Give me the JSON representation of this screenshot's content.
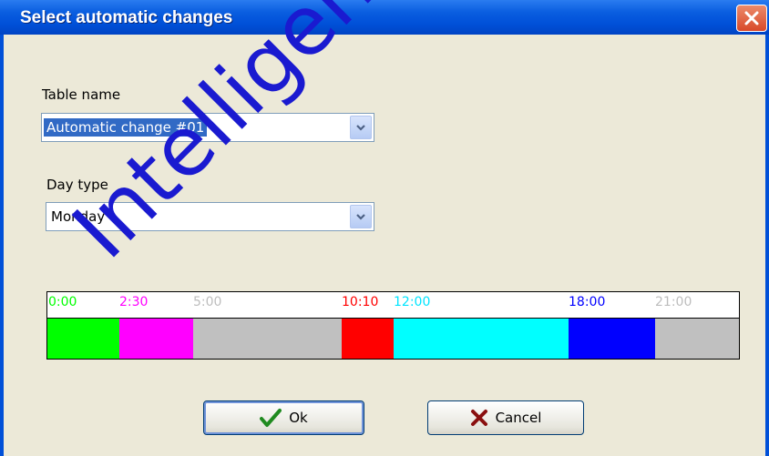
{
  "window": {
    "title": "Select automatic changes"
  },
  "fields": {
    "table_name": {
      "label": "Table name",
      "value": "Automatic change #01"
    },
    "day_type": {
      "label": "Day type",
      "value": "Monday"
    }
  },
  "timeline": {
    "ticks": [
      {
        "label": "0:00",
        "color": "#00ff00"
      },
      {
        "label": "2:30",
        "color": "#ff00ff"
      },
      {
        "label": "5:00",
        "color": "#bdbdbd"
      },
      {
        "label": "10:10",
        "color": "#ff0000"
      },
      {
        "label": "12:00",
        "color": "#00e5ff"
      },
      {
        "label": "18:00",
        "color": "#0000ff"
      },
      {
        "label": "21:00",
        "color": "#bdbdbd"
      }
    ],
    "segments": [
      {
        "color": "#00ff00"
      },
      {
        "color": "#ff00ff"
      },
      {
        "color": "#c0c0c0"
      },
      {
        "color": "#ff0000"
      },
      {
        "color": "#00ffff"
      },
      {
        "color": "#0000ff"
      },
      {
        "color": "#c0c0c0"
      }
    ]
  },
  "buttons": {
    "ok": "Ok",
    "cancel": "Cancel"
  },
  "watermark": "Intelligent Se"
}
